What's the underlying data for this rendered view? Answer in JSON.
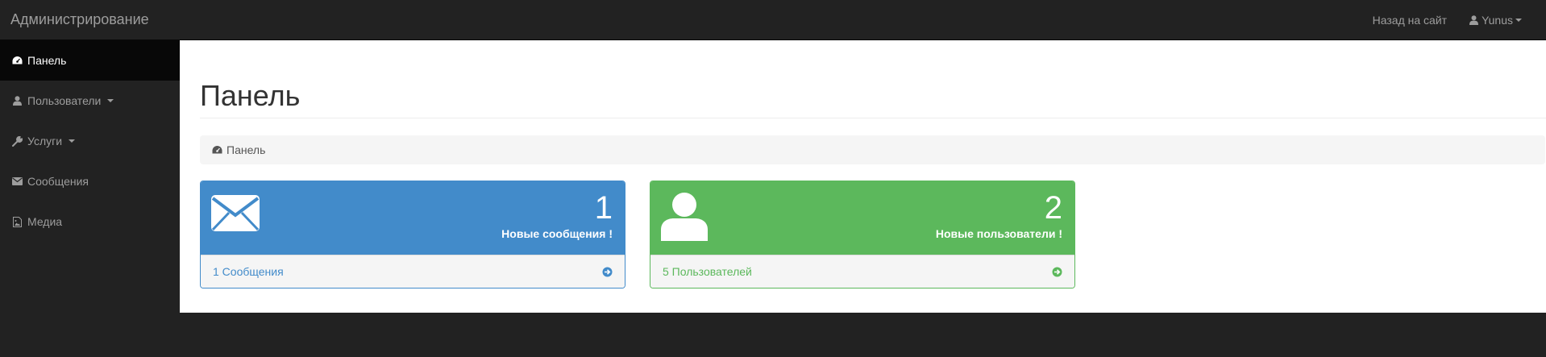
{
  "navbar": {
    "brand": "Администрирование",
    "back_link": "Назад на сайт",
    "user_name": "Yunus"
  },
  "sidebar": {
    "items": [
      {
        "label": "Панель",
        "icon": "dashboard-icon",
        "active": true
      },
      {
        "label": "Пользователи",
        "icon": "user-icon",
        "dropdown": true
      },
      {
        "label": "Услуги",
        "icon": "wrench-icon",
        "dropdown": true
      },
      {
        "label": "Сообщения",
        "icon": "envelope-icon"
      },
      {
        "label": "Медиа",
        "icon": "image-file-icon"
      }
    ]
  },
  "main": {
    "title": "Панель",
    "breadcrumb": "Панель",
    "panels": [
      {
        "count": "1",
        "caption": "Новые сообщения !",
        "link": "1 Сообщения",
        "icon": "envelope-icon",
        "color": "#428bca"
      },
      {
        "count": "2",
        "caption": "Новые пользователи !",
        "link": "5 Пользователей",
        "icon": "user-icon",
        "color": "#5cb85c"
      }
    ]
  },
  "colors": {
    "navbar_bg": "#222222",
    "sidebar_active_bg": "#080808",
    "primary": "#428bca",
    "success": "#5cb85c"
  }
}
